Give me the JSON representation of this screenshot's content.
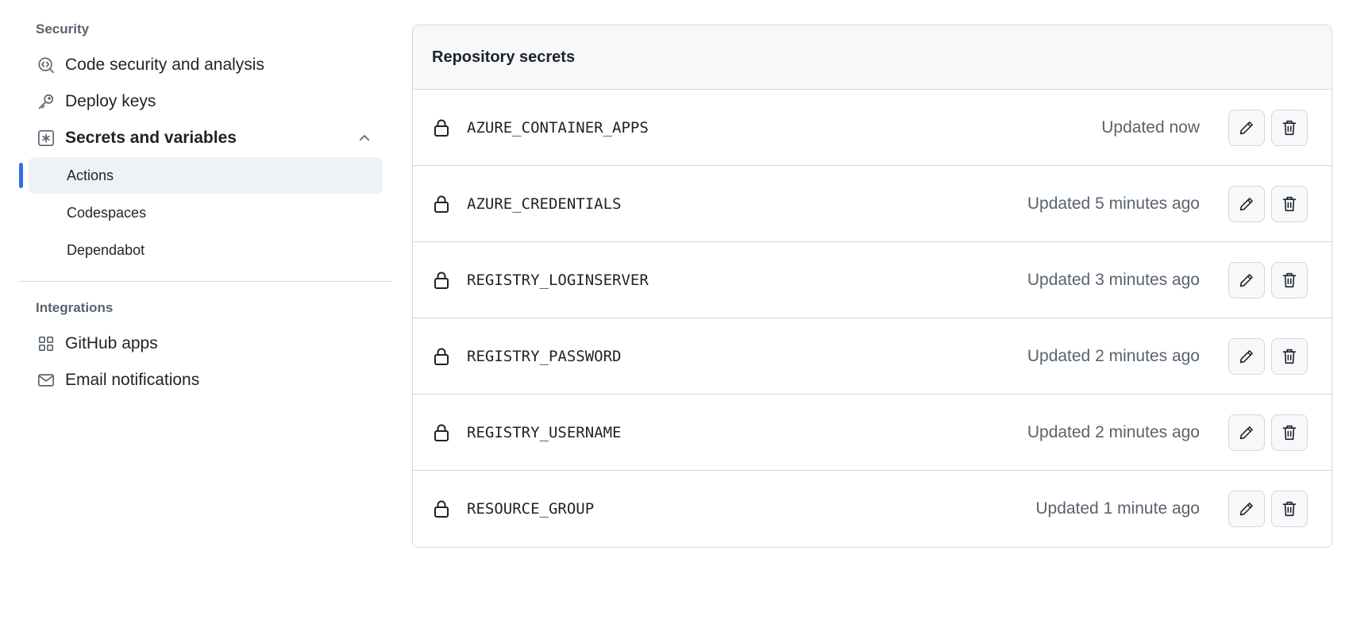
{
  "sidebar": {
    "security_heading": "Security",
    "security_items": [
      {
        "label": "Code security and analysis",
        "icon": "codescan-icon"
      },
      {
        "label": "Deploy keys",
        "icon": "key-icon"
      },
      {
        "label": "Secrets and variables",
        "icon": "asterisk-icon",
        "expanded": true
      }
    ],
    "secrets_subitems": [
      {
        "label": "Actions",
        "active": true
      },
      {
        "label": "Codespaces",
        "active": false
      },
      {
        "label": "Dependabot",
        "active": false
      }
    ],
    "integrations_heading": "Integrations",
    "integrations_items": [
      {
        "label": "GitHub apps",
        "icon": "apps-icon"
      },
      {
        "label": "Email notifications",
        "icon": "mail-icon"
      }
    ],
    "active_color": "#2f6feb"
  },
  "secrets_panel": {
    "title": "Repository secrets",
    "rows": [
      {
        "name": "AZURE_CONTAINER_APPS",
        "updated": "Updated now"
      },
      {
        "name": "AZURE_CREDENTIALS",
        "updated": "Updated 5 minutes ago"
      },
      {
        "name": "REGISTRY_LOGINSERVER",
        "updated": "Updated 3 minutes ago"
      },
      {
        "name": "REGISTRY_PASSWORD",
        "updated": "Updated 2 minutes ago"
      },
      {
        "name": "REGISTRY_USERNAME",
        "updated": "Updated 2 minutes ago"
      },
      {
        "name": "RESOURCE_GROUP",
        "updated": "Updated 1 minute ago"
      }
    ]
  }
}
